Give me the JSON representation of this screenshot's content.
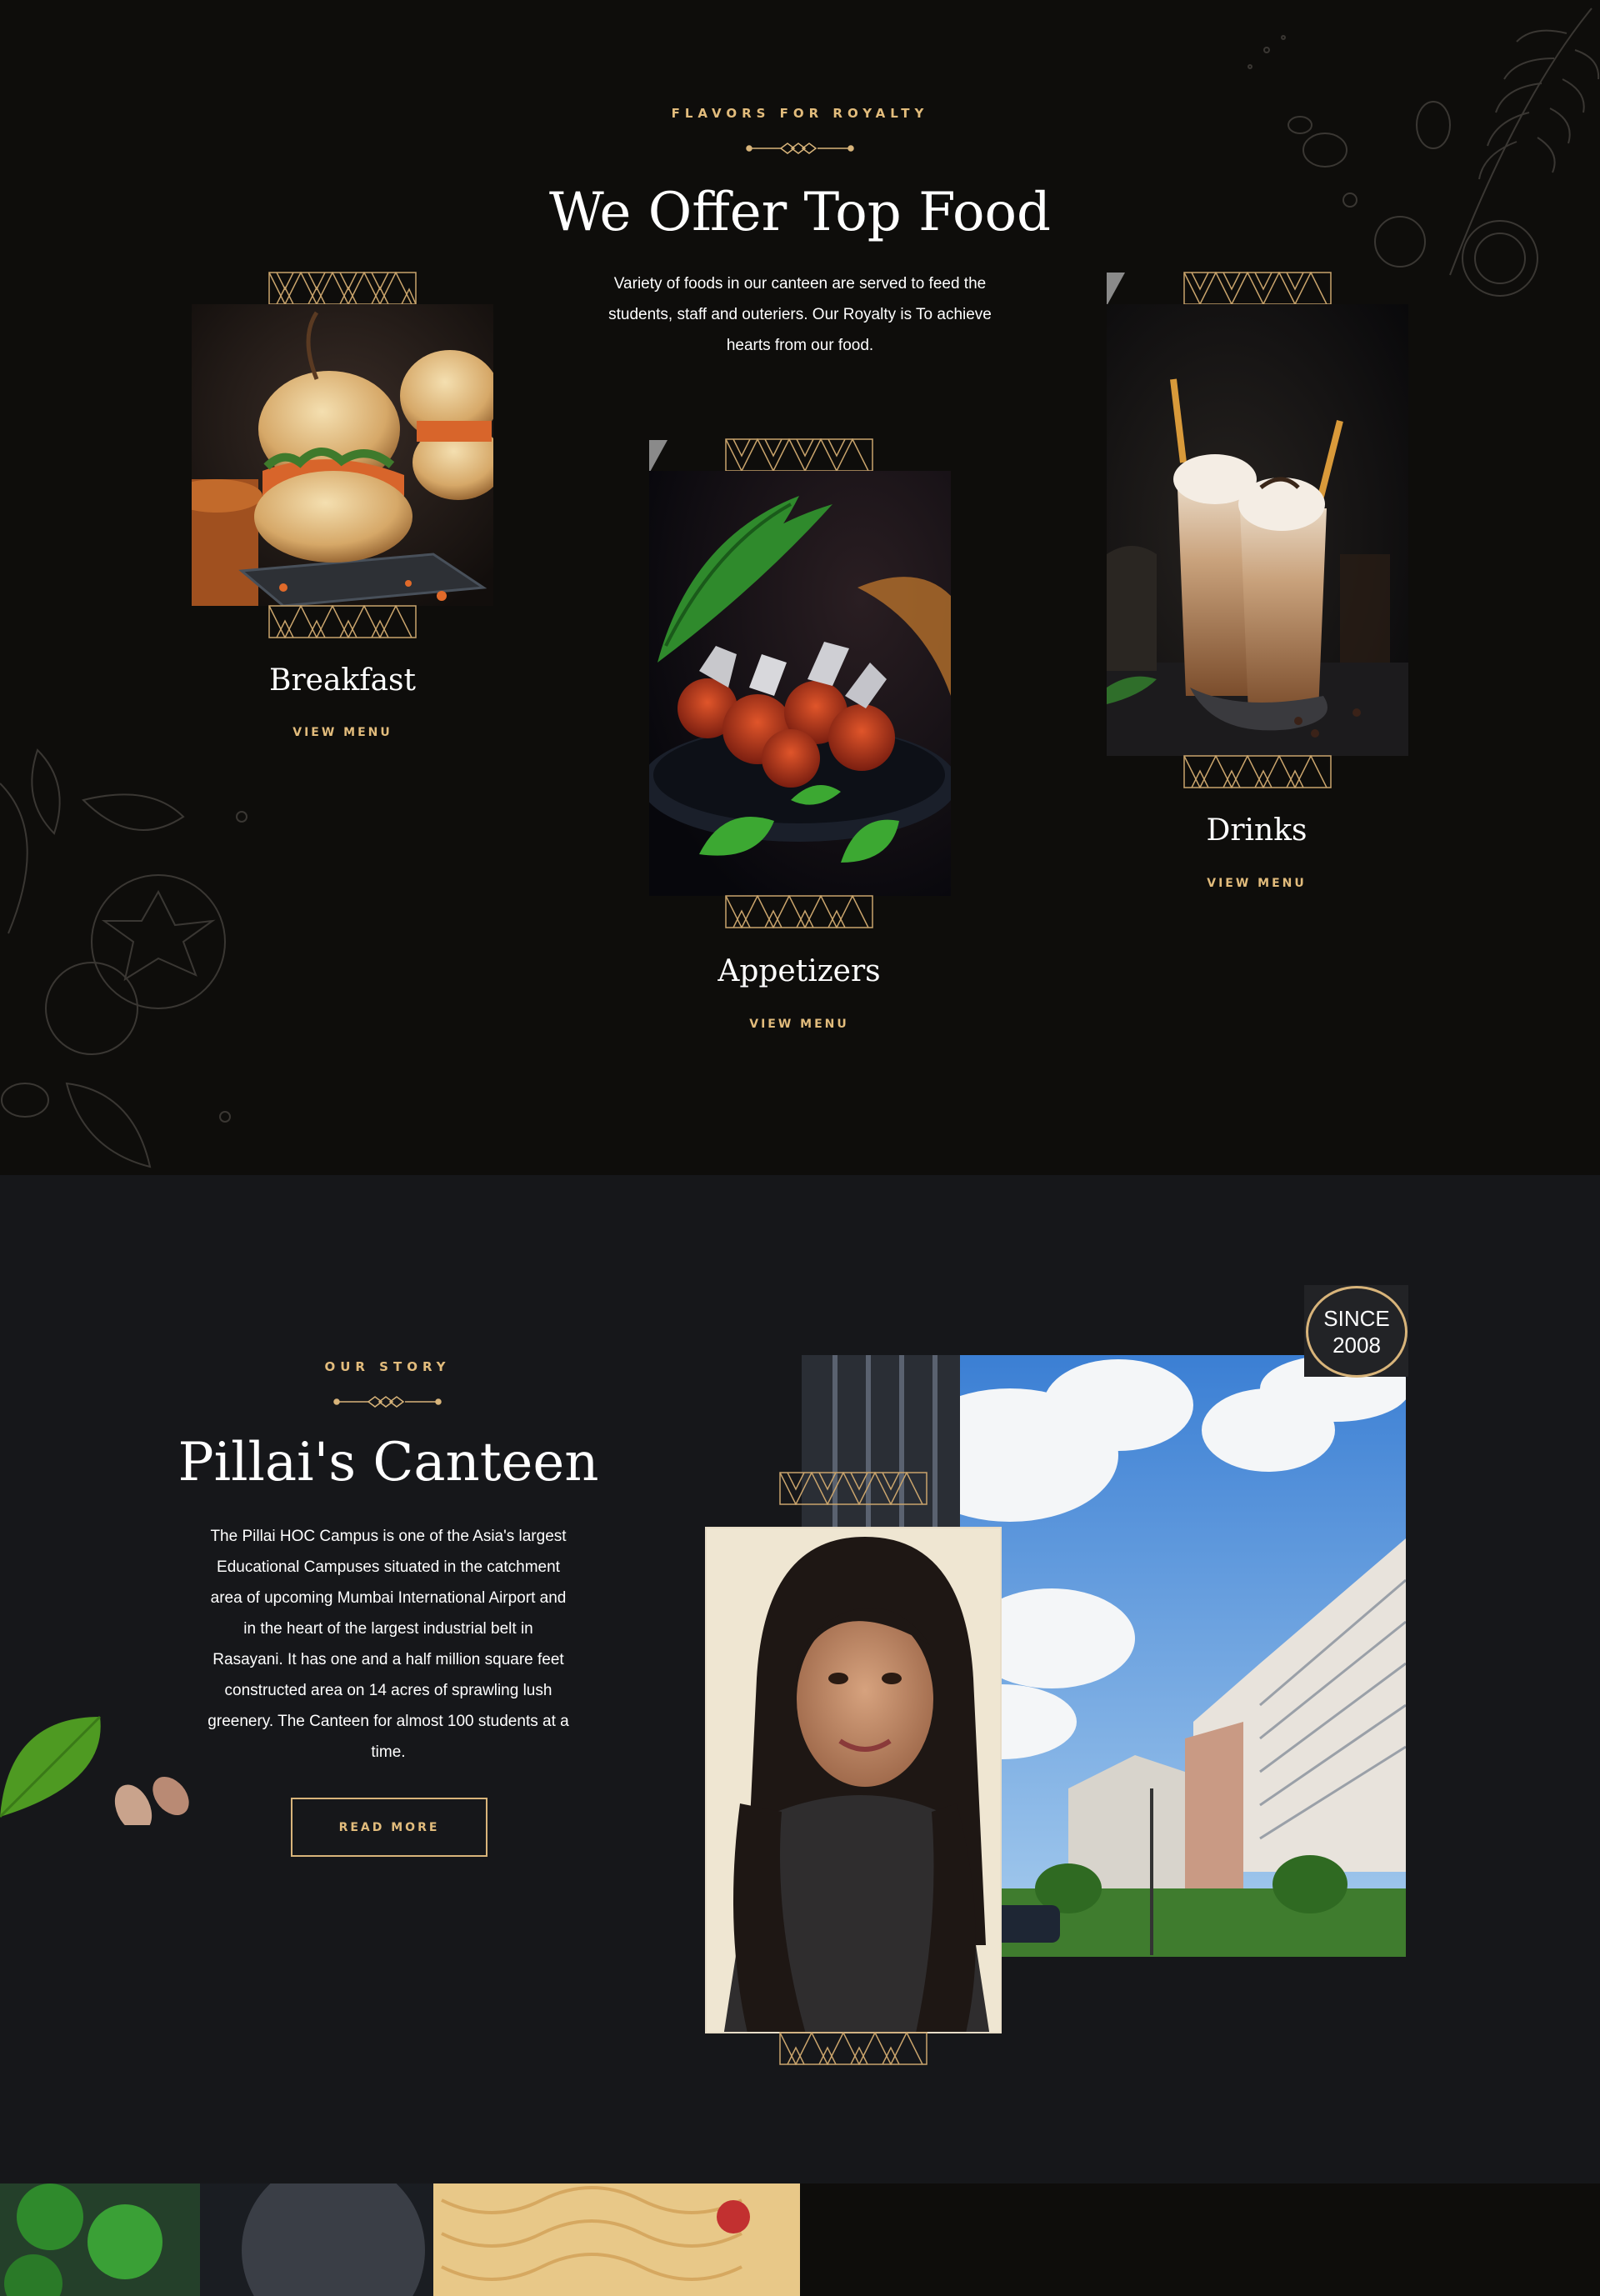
{
  "offer": {
    "eyebrow": "FLAVORS FOR ROYALTY",
    "title": "We Offer Top Food",
    "description_lines": [
      "Variety of foods in our canteen are served to feed the",
      "students, staff and outeriers. Our Royalty is To achieve",
      "hearts from our food."
    ],
    "categories": [
      {
        "name": "Breakfast",
        "link": "VIEW MENU",
        "image": "vada-pav-photo"
      },
      {
        "name": "Appetizers",
        "link": "VIEW MENU",
        "image": "chicken-lollipop-photo"
      },
      {
        "name": "Drinks",
        "link": "VIEW MENU",
        "image": "cold-coffee-photo"
      }
    ]
  },
  "story": {
    "eyebrow": "OUR STORY",
    "title": "Pillai's Canteen",
    "description_lines": [
      "The Pillai HOC Campus is one of the Asia's largest",
      "Educational Campuses situated in the catchment",
      "area of upcoming Mumbai International Airport and",
      "in the heart of the largest industrial belt in",
      "Rasayani. It has one and a half million square feet",
      "constructed area on 14 acres of sprawling lush",
      "greenery. The Canteen for almost 100 students at a",
      "time."
    ],
    "button": "READ MORE",
    "badge_line1": "SINCE",
    "badge_line2": "2008"
  },
  "colors": {
    "background": "#0e0d0b",
    "story_background": "#16171a",
    "accent_gold": "#e2bc7c"
  }
}
